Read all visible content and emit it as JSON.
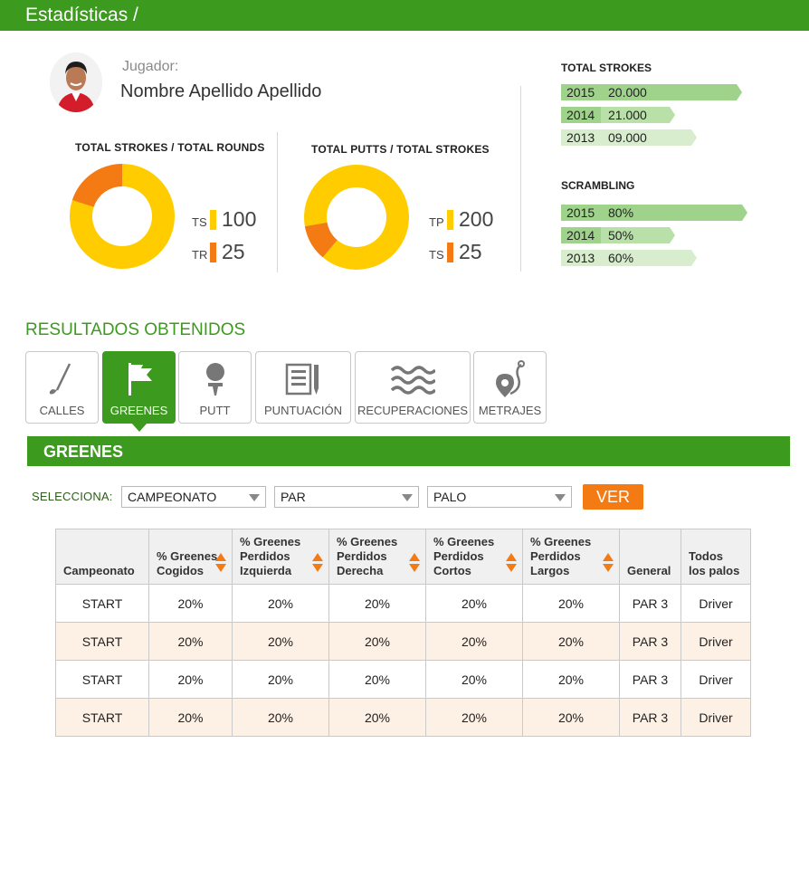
{
  "header": {
    "title": "Estadísticas /"
  },
  "player": {
    "label": "Jugador:",
    "name": "Nombre Apellido Apellido"
  },
  "charts": {
    "strokes_rounds": {
      "title": "TOTAL STROKES / TOTAL ROUNDS",
      "items": [
        {
          "abbr": "TS",
          "value": "100",
          "color": "#ffcc00"
        },
        {
          "abbr": "TR",
          "value": "25",
          "color": "#f47b13"
        }
      ]
    },
    "putts_strokes": {
      "title": "TOTAL PUTTS / TOTAL STROKES",
      "items": [
        {
          "abbr": "TP",
          "value": "200",
          "color": "#ffcc00"
        },
        {
          "abbr": "TS",
          "value": "25",
          "color": "#f47b13"
        }
      ]
    }
  },
  "chart_data": [
    {
      "type": "pie",
      "title": "TOTAL STROKES / TOTAL ROUNDS",
      "labels": [
        "TS",
        "TR"
      ],
      "values": [
        100,
        25
      ]
    },
    {
      "type": "pie",
      "title": "TOTAL PUTTS / TOTAL STROKES",
      "labels": [
        "TP",
        "TS"
      ],
      "values": [
        200,
        25
      ]
    }
  ],
  "total_strokes": {
    "title": "TOTAL STROKES",
    "rows": [
      {
        "year": "2015",
        "value": "20.000"
      },
      {
        "year": "2014",
        "value": "21.000"
      },
      {
        "year": "2013",
        "value": "09.000"
      }
    ]
  },
  "scrambling": {
    "title": "SCRAMBLING",
    "rows": [
      {
        "year": "2015",
        "value": "80%"
      },
      {
        "year": "2014",
        "value": "50%"
      },
      {
        "year": "2013",
        "value": "60%"
      }
    ]
  },
  "results": {
    "title": "RESULTADOS OBTENIDOS",
    "tabs": [
      {
        "label": "CALLES",
        "icon": "golf-club-icon",
        "active": false
      },
      {
        "label": "GREENES",
        "icon": "flag-icon",
        "active": true
      },
      {
        "label": "PUTT",
        "icon": "tee-icon",
        "active": false
      },
      {
        "label": "PUNTUACIÓN",
        "icon": "scorecard-icon",
        "active": false
      },
      {
        "label": "RECUPERACIONES",
        "icon": "waves-icon",
        "active": false
      },
      {
        "label": "METRAJES",
        "icon": "location-pin-icon",
        "active": false
      }
    ],
    "section_title": "GREENES"
  },
  "filters": {
    "label": "SELECCIONA:",
    "selects": [
      {
        "value": "CAMPEONATO"
      },
      {
        "value": "PAR"
      },
      {
        "value": "PALO"
      }
    ],
    "button": "VER"
  },
  "table": {
    "headers": [
      [
        "Campeonato"
      ],
      [
        "% Greenes",
        "Cogidos"
      ],
      [
        "% Greenes",
        "Perdidos",
        "Izquierda"
      ],
      [
        "% Greenes",
        "Perdidos",
        "Derecha"
      ],
      [
        "% Greenes",
        "Perdidos",
        "Cortos"
      ],
      [
        "% Greenes",
        "Perdidos",
        "Largos"
      ],
      [
        "General"
      ],
      [
        "Todos",
        "los palos"
      ]
    ],
    "rows": [
      [
        "START",
        "20%",
        "20%",
        "20%",
        "20%",
        "20%",
        "PAR 3",
        "Driver"
      ],
      [
        "START",
        "20%",
        "20%",
        "20%",
        "20%",
        "20%",
        "PAR 3",
        "Driver"
      ],
      [
        "START",
        "20%",
        "20%",
        "20%",
        "20%",
        "20%",
        "PAR 3",
        "Driver"
      ],
      [
        "START",
        "20%",
        "20%",
        "20%",
        "20%",
        "20%",
        "PAR 3",
        "Driver"
      ]
    ]
  },
  "colors": {
    "green": "#3c9a1e",
    "orange": "#f47b13",
    "yellow": "#ffcc00",
    "bar_dark": "#9fd38c",
    "bar_light": "#d7edcd",
    "row_alt": "#fdf0e4"
  }
}
